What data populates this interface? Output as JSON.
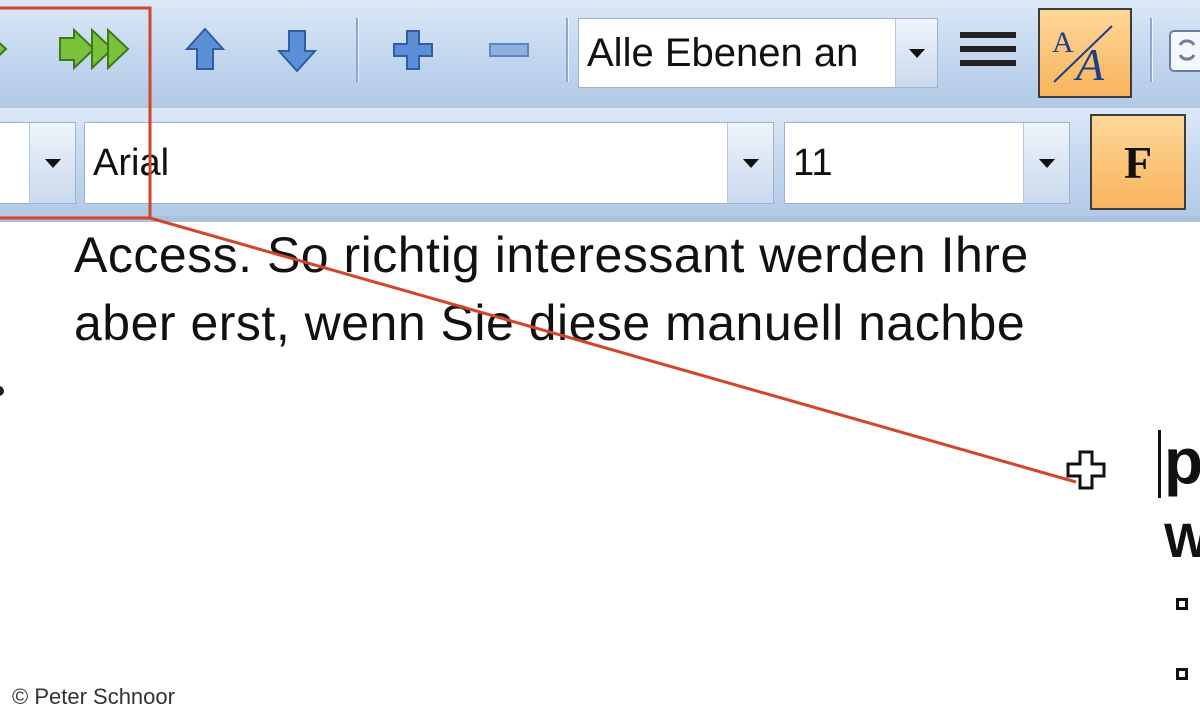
{
  "toolbar_top": {
    "level_select": {
      "value": "Alle Ebenen an"
    },
    "icons": [
      "arrow-right-icon",
      "double-arrow-right-icon",
      "arrow-up-icon",
      "arrow-down-icon",
      "plus-icon",
      "minus-icon",
      "lines-icon",
      "text-style-icon",
      "refresh-icon"
    ]
  },
  "toolbar_format": {
    "font_select": {
      "value": "Arial"
    },
    "size_select": {
      "value": "11"
    },
    "bold_label": "F"
  },
  "document": {
    "lines": [
      "Access. So richtig interessant werden Ihre",
      "aber erst, wenn Sie diese manuell nachbe"
    ],
    "fragment_heading": "p",
    "fragment_sub": "W"
  },
  "credit": "© Peter Schnoor",
  "colors": {
    "callout": "#d2452a",
    "accent_orange": "#f7b45c",
    "toolbar_blue": "#c2d6ee"
  }
}
